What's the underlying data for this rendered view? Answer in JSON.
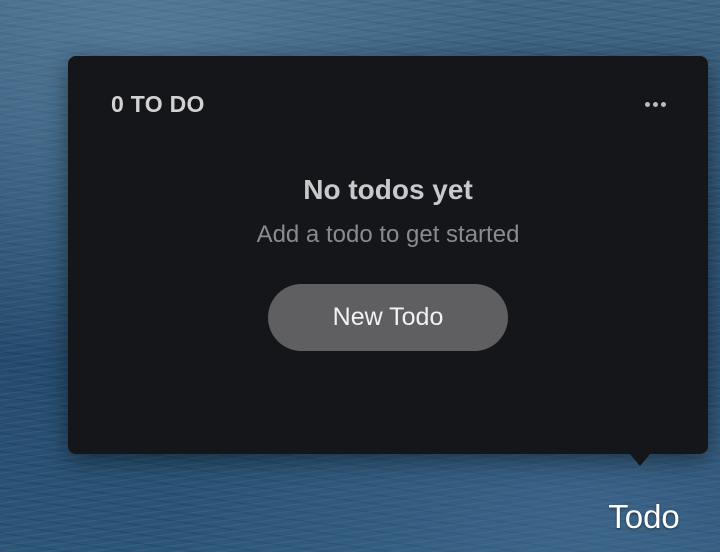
{
  "popover": {
    "count_title": "0 TO DO",
    "more_icon": "ellipsis-icon",
    "empty_state": {
      "title": "No todos yet",
      "subtitle": "Add a todo to get started"
    },
    "new_todo_label": "New Todo"
  },
  "menubar": {
    "item_label": "Todo"
  },
  "colors": {
    "popover_background": "#151619",
    "button_background": "#5f5f62",
    "title_text": "#d2d2d4",
    "subtitle_text": "#8a8b8f"
  }
}
